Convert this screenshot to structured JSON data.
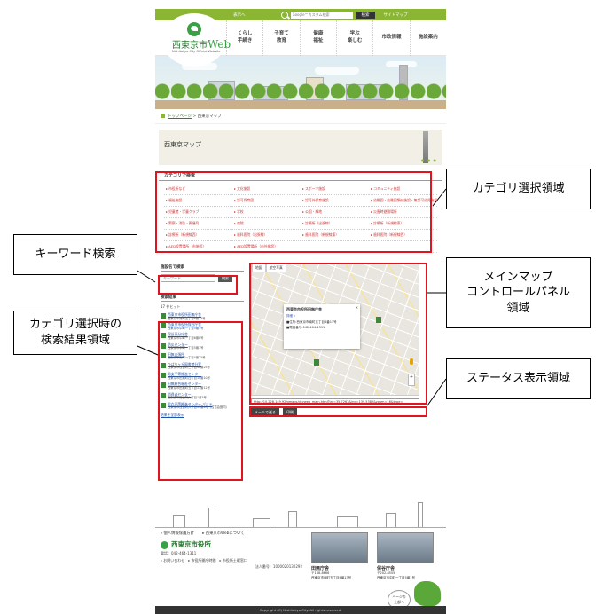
{
  "topbar": {
    "left_link": "表示へ",
    "search_placeholder": "Google™カスタム検索",
    "search_button": "検索",
    "sitemap": "サイトマップ"
  },
  "logo": {
    "title_prefix": "西東京市",
    "title_web": "Web",
    "subtitle": "Nishitokyo City Official Website"
  },
  "gnav": [
    "くらし\n手続き",
    "子育て\n教育",
    "健康\n福祉",
    "学ぶ\n楽しむ",
    "市政情報",
    "施設案内"
  ],
  "breadcrumb": {
    "home": "トップページ",
    "sep": ">",
    "current": "西東京マップ"
  },
  "page_title": "西東京マップ",
  "categories": {
    "heading": "カテゴリで検索",
    "items": [
      "▸ 市役所など",
      "▸ 文化施設",
      "▸ スポーツ施設",
      "▸ コミュニティ施設",
      "▸ 福祉施設",
      "▸ 認可保育園",
      "▸ 認可外保育施設",
      "▸ 幼稚園・幼稚園類似施設・無認可幼児施設",
      "▸ 児童館・学童クラブ",
      "▸ 学校",
      "▸ 公園・緑地",
      "▸ 災害時避難場所",
      "▸ 警察・消防・郵便局",
      "▸ 病院",
      "▸ 診療所（出張線）",
      "▸ 診療所（新規線東）",
      "▸ 診療所（新規線西）",
      "▸ 歯科医院（出張線）",
      "▸ 歯科医院（新規線東）",
      "▸ 歯科医院（新規線西）",
      "▸ AED設置場所（市施設）",
      "▸ AED設置場所（市外施設）",
      "",
      ""
    ]
  },
  "keyword": {
    "heading": "施設名で検索",
    "placeholder": "キーワード",
    "button": "検索"
  },
  "results": {
    "heading": "検索結果",
    "hits": "17 件ヒット",
    "items": [
      {
        "name": "西東京市役所田無庁舎",
        "addr": "西東京市南町五丁目6番13号"
      },
      {
        "name": "西東京市役所保谷庁舎",
        "addr": "西東京市中町一丁目5番1号"
      },
      {
        "name": "保谷東分庁舎",
        "addr": "西東京市中町一丁目6番8号"
      },
      {
        "name": "防災センター",
        "addr": "西東京市中町一丁目5番1号"
      },
      {
        "name": "田無出張所",
        "addr": "西東京市南町一丁目4番25号"
      },
      {
        "name": "ひばりヶ丘図書館分室",
        "addr": "西東京市住吉町三丁目10番25号"
      },
      {
        "name": "男女平等推進センター",
        "addr": "西東京市田無町四丁目10番10号"
      },
      {
        "name": "田無総合福祉センター",
        "addr": "西東京市田無町五丁目13番12号"
      },
      {
        "name": "消費者センター",
        "addr": "西東京市住吉町六丁目1番3号"
      },
      {
        "name": "男女平等推進センター パリテ",
        "addr": "西東京市住吉町六丁目15番6号（住吉会館内）"
      }
    ],
    "show_all": "結果を全部表示"
  },
  "map": {
    "tabs": [
      "地図",
      "航空写真"
    ],
    "popup_title": "西東京市役所田無庁舎",
    "popup_link": "詳細 »",
    "popup_addr": "■住所:西東京市南町五丁目6番13号",
    "popup_tel": "■電話番号:042-464-1311",
    "zoom_in": "+",
    "zoom_out": "−",
    "status_url": "http://10.228.149.92/gmaps/cityweb_main.html?lat=35.7263&lng=139.5382&zoom=16&type=",
    "btn_mail": "メールで送る",
    "btn_print": "印刷"
  },
  "footer": {
    "links": [
      "▸ 個人情報保護方針",
      "▸ 西東京市Webについて"
    ],
    "org": "西東京市役所",
    "tel": "電話：042-464-1311",
    "hours": "▸ お問い合わせ　▸ 市役所開庁時間　▸ 市役所土曜窓口",
    "corp": "法人番号：1000020132292",
    "office1_name": "田無庁舎",
    "office1_addr": "〒188-8666\n西東京市南町五丁目6番13号",
    "office2_name": "保谷庁舎",
    "office2_addr": "〒202-8555\n西東京市中町一丁目5番1号",
    "pagetop": "ページの\n上部へ",
    "copyright": "Copyright (C) Nishitokyo City. All rights reserved."
  },
  "callouts": {
    "category": "カテゴリ選択領域",
    "keyword": "キーワード検索",
    "results": "カテゴリ選択時の\n検索結果領域",
    "map": "メインマップ\nコントロールパネル\n領域",
    "status": "ステータス表示領域"
  },
  "colors": {
    "brand_green": "#8ab634",
    "annotation_red": "#e0141e"
  }
}
